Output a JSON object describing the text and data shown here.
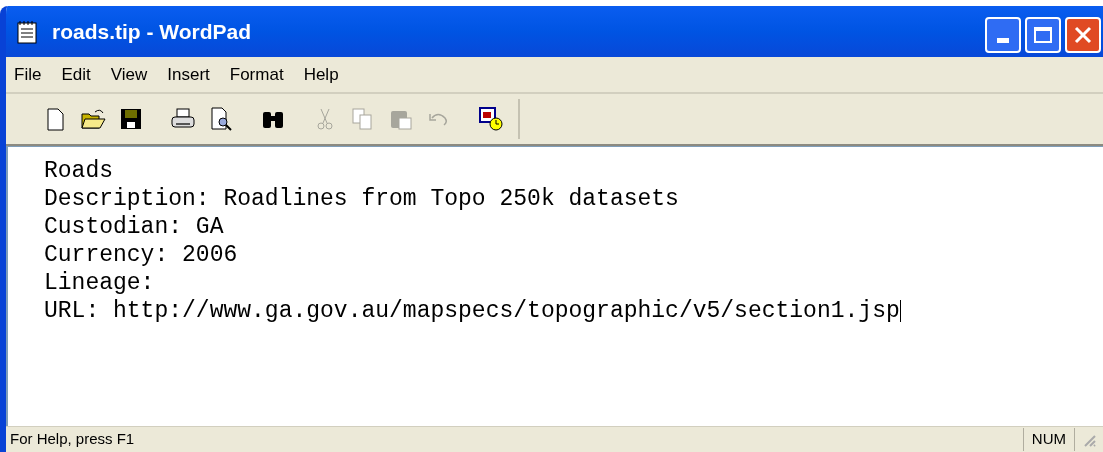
{
  "window": {
    "title": "roads.tip - WordPad"
  },
  "menu": [
    {
      "label": "File"
    },
    {
      "label": "Edit"
    },
    {
      "label": "View"
    },
    {
      "label": "Insert"
    },
    {
      "label": "Format"
    },
    {
      "label": "Help"
    }
  ],
  "toolbar": [
    {
      "kind": "new",
      "disabled": false
    },
    {
      "kind": "open",
      "disabled": false
    },
    {
      "kind": "save",
      "disabled": false
    },
    {
      "kind": "gap"
    },
    {
      "kind": "print",
      "disabled": false
    },
    {
      "kind": "preview",
      "disabled": false
    },
    {
      "kind": "gap"
    },
    {
      "kind": "find",
      "disabled": false
    },
    {
      "kind": "gap"
    },
    {
      "kind": "cut",
      "disabled": true
    },
    {
      "kind": "copy",
      "disabled": true
    },
    {
      "kind": "paste",
      "disabled": true
    },
    {
      "kind": "undo",
      "disabled": true
    },
    {
      "kind": "gap"
    },
    {
      "kind": "datetime",
      "disabled": false
    }
  ],
  "document": {
    "lines": [
      "Roads",
      "Description: Roadlines from Topo 250k datasets",
      "Custodian: GA",
      "Currency: 2006",
      "Lineage:",
      "URL: http://www.ga.gov.au/mapspecs/topographic/v5/section1.jsp"
    ]
  },
  "status_bar": {
    "help": "For Help, press F1",
    "num": "NUM"
  }
}
